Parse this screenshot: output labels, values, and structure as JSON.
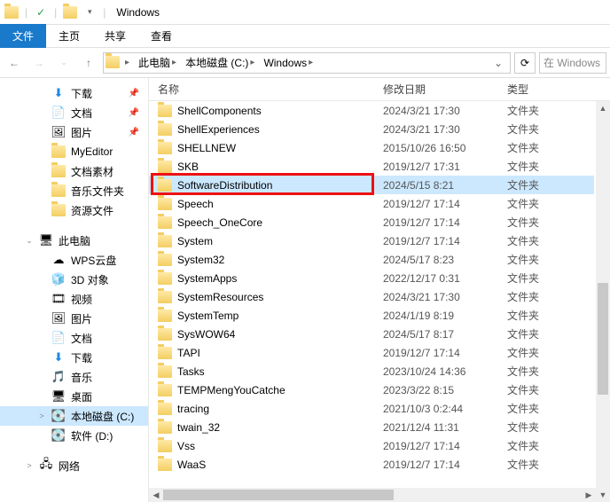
{
  "window": {
    "title": "Windows"
  },
  "ribbon": {
    "file": "文件",
    "tabs": [
      "主页",
      "共享",
      "查看"
    ]
  },
  "breadcrumb": {
    "items": [
      "此电脑",
      "本地磁盘 (C:)",
      "Windows"
    ]
  },
  "search": {
    "placeholder": "在 Windows"
  },
  "nav": {
    "quick": [
      {
        "label": "下载",
        "icon": "download",
        "pinned": true
      },
      {
        "label": "文档",
        "icon": "doc",
        "pinned": true
      },
      {
        "label": "图片",
        "icon": "pic",
        "pinned": true
      },
      {
        "label": "MyEditor",
        "icon": "folder"
      },
      {
        "label": "文档素材",
        "icon": "folder"
      },
      {
        "label": "音乐文件夹",
        "icon": "folder"
      },
      {
        "label": "资源文件",
        "icon": "folder"
      }
    ],
    "thispc_label": "此电脑",
    "thispc": [
      {
        "label": "WPS云盘",
        "icon": "wps"
      },
      {
        "label": "3D 对象",
        "icon": "3d"
      },
      {
        "label": "视频",
        "icon": "video"
      },
      {
        "label": "图片",
        "icon": "pic"
      },
      {
        "label": "文档",
        "icon": "doc"
      },
      {
        "label": "下载",
        "icon": "download"
      },
      {
        "label": "音乐",
        "icon": "music"
      },
      {
        "label": "桌面",
        "icon": "desktop"
      },
      {
        "label": "本地磁盘 (C:)",
        "icon": "drive",
        "selected": true
      },
      {
        "label": "软件 (D:)",
        "icon": "drive"
      }
    ],
    "network_label": "网络"
  },
  "columns": {
    "name": "名称",
    "date": "修改日期",
    "type": "类型"
  },
  "folder_type": "文件夹",
  "files": [
    {
      "name": "ShellComponents",
      "date": "2024/3/21 17:30"
    },
    {
      "name": "ShellExperiences",
      "date": "2024/3/21 17:30"
    },
    {
      "name": "SHELLNEW",
      "date": "2015/10/26 16:50"
    },
    {
      "name": "SKB",
      "date": "2019/12/7 17:31"
    },
    {
      "name": "SoftwareDistribution",
      "date": "2024/5/15 8:21",
      "selected": true,
      "highlighted": true
    },
    {
      "name": "Speech",
      "date": "2019/12/7 17:14"
    },
    {
      "name": "Speech_OneCore",
      "date": "2019/12/7 17:14"
    },
    {
      "name": "System",
      "date": "2019/12/7 17:14"
    },
    {
      "name": "System32",
      "date": "2024/5/17 8:23"
    },
    {
      "name": "SystemApps",
      "date": "2022/12/17 0:31"
    },
    {
      "name": "SystemResources",
      "date": "2024/3/21 17:30"
    },
    {
      "name": "SystemTemp",
      "date": "2024/1/19 8:19"
    },
    {
      "name": "SysWOW64",
      "date": "2024/5/17 8:17"
    },
    {
      "name": "TAPI",
      "date": "2019/12/7 17:14"
    },
    {
      "name": "Tasks",
      "date": "2023/10/24 14:36"
    },
    {
      "name": "TEMPMengYouCatche",
      "date": "2023/3/22 8:15"
    },
    {
      "name": "tracing",
      "date": "2021/10/3 0:2:44"
    },
    {
      "name": "twain_32",
      "date": "2021/12/4 11:31"
    },
    {
      "name": "Vss",
      "date": "2019/12/7 17:14"
    },
    {
      "name": "WaaS",
      "date": "2019/12/7 17:14"
    }
  ]
}
